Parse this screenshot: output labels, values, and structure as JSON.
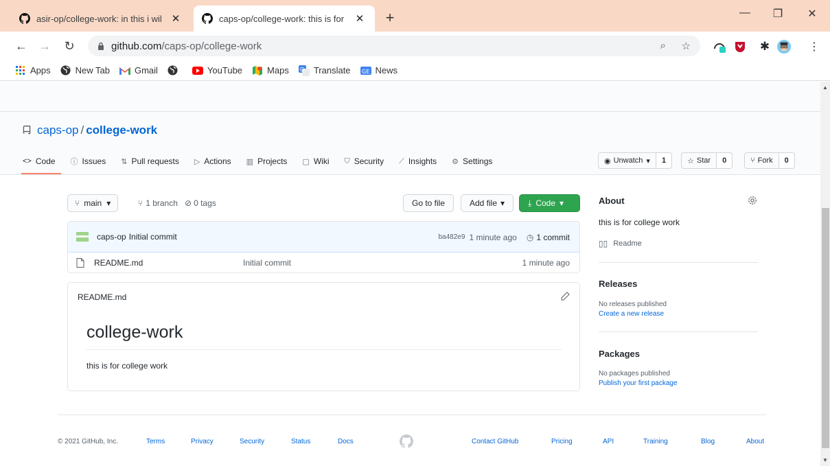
{
  "browser": {
    "tabs": [
      {
        "title": "asir-op/college-work: in this i wil",
        "active": false
      },
      {
        "title": "caps-op/college-work: this is for ",
        "active": true
      }
    ],
    "new_tab": "+",
    "window_controls": {
      "minimize": "—",
      "restore": "❐",
      "close": "✕"
    },
    "url": {
      "domain": "github.com",
      "path": "/caps-op/college-work"
    },
    "bookmarks": [
      {
        "label": "Apps",
        "icon": "apps-grid-icon"
      },
      {
        "label": "New Tab",
        "icon": "globe-icon"
      },
      {
        "label": "Gmail",
        "icon": "gmail-icon"
      },
      {
        "label": "",
        "icon": "globe-icon"
      },
      {
        "label": "YouTube",
        "icon": "youtube-icon"
      },
      {
        "label": "Maps",
        "icon": "maps-icon"
      },
      {
        "label": "Translate",
        "icon": "translate-icon"
      },
      {
        "label": "News",
        "icon": "news-icon"
      }
    ]
  },
  "repo": {
    "owner": "caps-op",
    "separator": "/",
    "name": "college-work",
    "watch": {
      "label": "Unwatch",
      "count": "1"
    },
    "star": {
      "label": "Star",
      "count": "0"
    },
    "fork": {
      "label": "Fork",
      "count": "0"
    },
    "nav": [
      {
        "label": "Code",
        "icon": "<>",
        "selected": true
      },
      {
        "label": "Issues",
        "icon": "ⓘ"
      },
      {
        "label": "Pull requests",
        "icon": "⇅"
      },
      {
        "label": "Actions",
        "icon": "▷"
      },
      {
        "label": "Projects",
        "icon": "▥"
      },
      {
        "label": "Wiki",
        "icon": "▢"
      },
      {
        "label": "Security",
        "icon": "⛉"
      },
      {
        "label": "Insights",
        "icon": "⟋"
      },
      {
        "label": "Settings",
        "icon": "⚙"
      }
    ],
    "branch": "main",
    "branches": "1 branch",
    "tags": "0 tags",
    "go_to_file": "Go to file",
    "add_file": "Add file",
    "code_button": "Code",
    "commit": {
      "author": "caps-op",
      "message": "Initial commit",
      "sha": "ba482e9",
      "age": "1 minute ago",
      "commits": "1 commit"
    },
    "files": [
      {
        "name": "README.md",
        "message": "Initial commit",
        "age": "1 minute ago"
      }
    ],
    "readme": {
      "filename": "README.md",
      "heading": "college-work",
      "text": "this is for college work"
    },
    "about": {
      "title": "About",
      "description": "this is for college work",
      "readme_link": "Readme"
    },
    "releases": {
      "title": "Releases",
      "none": "No releases published",
      "create": "Create a new release"
    },
    "packages": {
      "title": "Packages",
      "none": "No packages published",
      "publish": "Publish your first package"
    }
  },
  "footer": {
    "copyright": "© 2021 GitHub, Inc.",
    "left_links": [
      "Terms",
      "Privacy",
      "Security",
      "Status",
      "Docs"
    ],
    "right_links": [
      "Contact GitHub",
      "Pricing",
      "API",
      "Training",
      "Blog",
      "About"
    ]
  },
  "colors": {
    "tab_strip": "#f9d9c6",
    "link": "#0366d6",
    "green_button": "#2ea44f",
    "nav_underline": "#f9826c"
  }
}
